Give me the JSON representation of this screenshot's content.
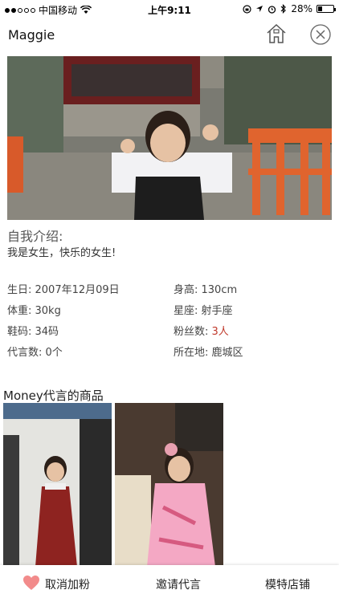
{
  "status_bar": {
    "carrier": "中国移动",
    "time": "上午9:11",
    "battery": "28%",
    "battery_level": 0.28
  },
  "nav": {
    "title": "Maggie",
    "home_icon": "home-icon",
    "close_icon": "close-icon"
  },
  "intro": {
    "heading": "自我介绍:",
    "text": "我是女生，快乐的女生!"
  },
  "info": {
    "birthday": "生日: 2007年12月09日",
    "height": "身高: 130cm",
    "weight": "体重: 30kg",
    "constellation": "星座: 射手座",
    "shoe_size": "鞋码: 34码",
    "fans_label": "粉丝数: ",
    "fans_count": "3",
    "fans_unit": "人",
    "endorsements": "代言数: 0个",
    "location": "所在地: 鹿城区"
  },
  "products": {
    "heading": "Money代言的商品"
  },
  "bottom_bar": {
    "unfollow": "取消加粉",
    "invite": "邀请代言",
    "shop": "模特店铺",
    "heart_color": "#f28b8b"
  }
}
